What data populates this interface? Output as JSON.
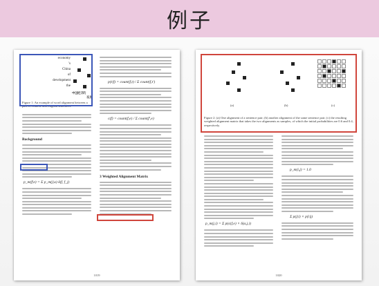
{
  "slide": {
    "title": "例子"
  },
  "left_page": {
    "matrix_labels_rows": [
      "economy",
      "'s",
      "China",
      "of",
      "development",
      "the"
    ],
    "matrix_labels_cols": [
      "中国",
      "经济",
      "的",
      "发展"
    ],
    "figure_caption": "Figure 1: An example of word alignment between a pair of Chinese and English sentences.",
    "section_1": "Background",
    "section_2": "3  Weighted Alignment Matrix",
    "equation_1": "p(t|f) = count(f,t) / Σ count(f,t')",
    "equation_2": "c(f) = count(f,e) / Σ count(f',e)",
    "equation_3": "p_m(f|e) = Σ p_m(j|a) δ(f, f_j)",
    "page_number": "1019"
  },
  "right_page": {
    "subfigure_labels": [
      "(a)",
      "(b)",
      "(c)"
    ],
    "figure_caption": "Figure 2: (a) One alignment of a sentence pair; (b) another alignment of the same sentence pair; (c) the resulting weighted alignment matrix that takes the two alignments as samples, of which the initial probabilities are 0.6 and 0.4, respectively.",
    "equation_1": "p_m(j,i) = Σ p(a|f,e) × δ(a,j,i)",
    "equation_2": "p_m(i,j) = 1.0",
    "equation_3": "Σ p(j|i) × p(i|j)",
    "page_number": "1020"
  },
  "highlight_colors": {
    "left_box": "#3b56b8",
    "right_box": "#d0453b",
    "banner": "#ecc9df"
  }
}
